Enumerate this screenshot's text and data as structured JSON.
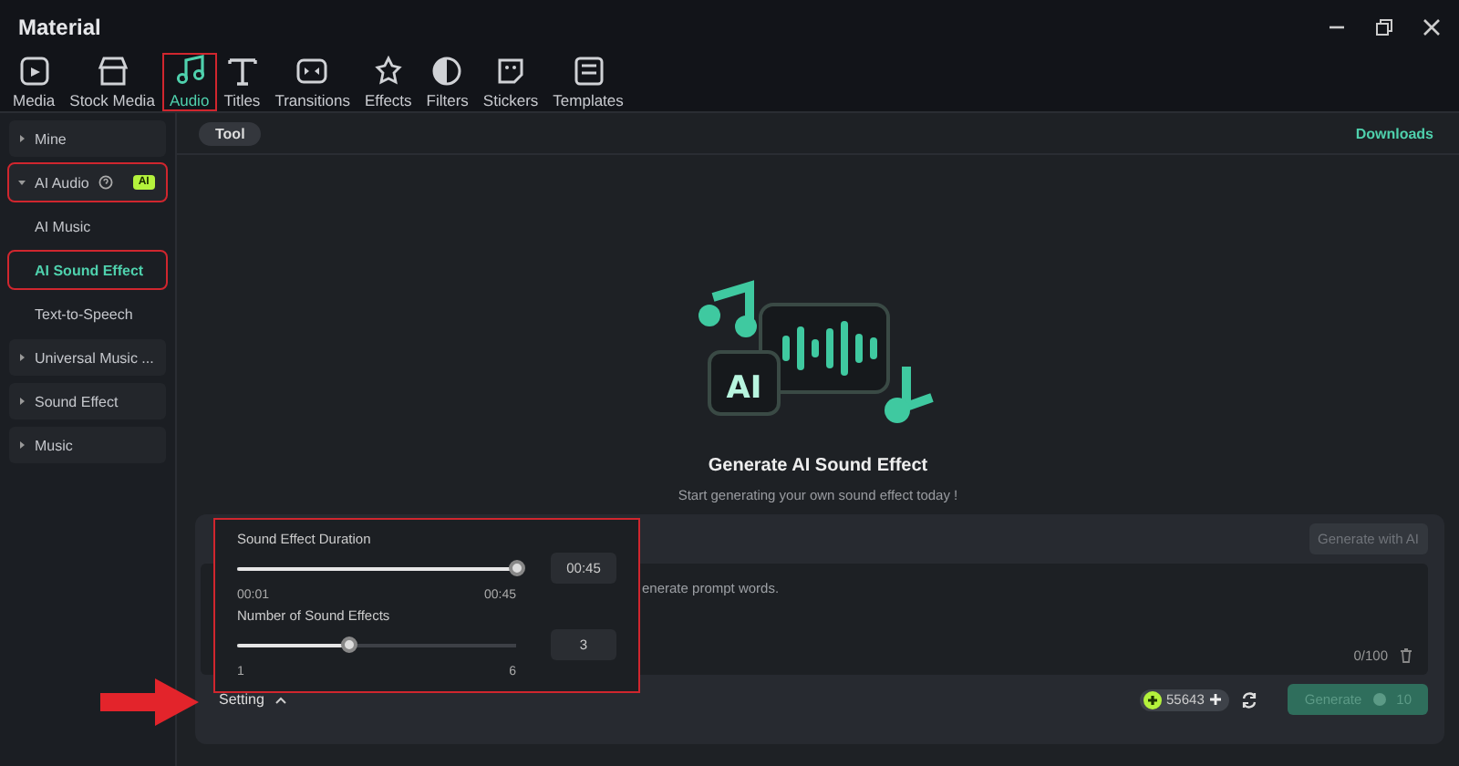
{
  "window": {
    "title": "Material"
  },
  "tabs": [
    {
      "label": "Media",
      "selected": false,
      "highlighted": false
    },
    {
      "label": "Stock Media",
      "selected": false,
      "highlighted": false
    },
    {
      "label": "Audio",
      "selected": true,
      "highlighted": true
    },
    {
      "label": "Titles",
      "selected": false,
      "highlighted": false
    },
    {
      "label": "Transitions",
      "selected": false,
      "highlighted": false
    },
    {
      "label": "Effects",
      "selected": false,
      "highlighted": false
    },
    {
      "label": "Filters",
      "selected": false,
      "highlighted": false
    },
    {
      "label": "Stickers",
      "selected": false,
      "highlighted": false
    },
    {
      "label": "Templates",
      "selected": false,
      "highlighted": false
    }
  ],
  "sidebar": {
    "items": [
      {
        "label": "Mine",
        "expanded": false,
        "selected": false,
        "highlighted": false
      },
      {
        "label": "AI Audio",
        "badge": "AI",
        "help": true,
        "expanded": true,
        "selected": false,
        "highlighted": true,
        "children": [
          {
            "label": "AI Music",
            "selected": false,
            "highlighted": false
          },
          {
            "label": "AI Sound Effect",
            "selected": true,
            "highlighted": true
          },
          {
            "label": "Text-to-Speech",
            "selected": false,
            "highlighted": false
          }
        ]
      },
      {
        "label": "Universal Music ...",
        "expanded": false,
        "selected": false,
        "highlighted": false
      },
      {
        "label": "Sound Effect",
        "expanded": false,
        "selected": false,
        "highlighted": false
      },
      {
        "label": "Music",
        "expanded": false,
        "selected": false,
        "highlighted": false
      }
    ]
  },
  "main": {
    "chip": "Tool",
    "illustration_text": "AI",
    "downloads": "Downloads",
    "heading": "Generate AI Sound Effect",
    "subheading": "Start generating your own sound effect today !"
  },
  "prompt": {
    "generate_with_ai": {
      "label": "Generate with AI",
      "disabled": true
    },
    "text": "enerate prompt words.",
    "counter": "0/100"
  },
  "settings_popup": {
    "highlighted": true,
    "sliders": [
      {
        "label": "Sound Effect Duration",
        "level": 1.0,
        "value": "00:45",
        "min": "00:01",
        "max": "00:45"
      },
      {
        "label": "Number of Sound Effects",
        "level": 0.4,
        "value": "3",
        "min": "1",
        "max": "6"
      }
    ]
  },
  "footer": {
    "setting": "Setting",
    "arrow_annotation": true,
    "credits": "55643",
    "generate": {
      "label": "Generate",
      "cost": "10",
      "disabled": true
    }
  }
}
